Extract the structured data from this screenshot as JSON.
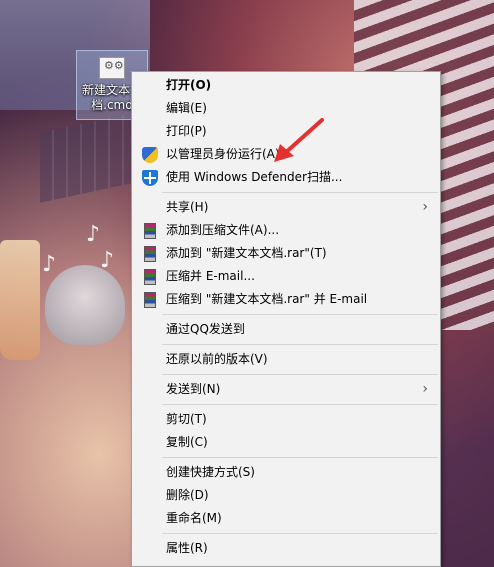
{
  "desktop": {
    "icon_label_line1": "新建文本文",
    "icon_label_line2": "档.cmd"
  },
  "menu": {
    "items": [
      {
        "label": "打开(O)",
        "bold": true
      },
      {
        "label": "编辑(E)"
      },
      {
        "label": "打印(P)"
      },
      {
        "label": "以管理员身份运行(A)",
        "icon": "uac-shield-icon"
      },
      {
        "label": "使用 Windows Defender扫描...",
        "icon": "defender-icon"
      },
      {
        "label": "共享(H)",
        "submenu": true
      },
      {
        "label": "添加到压缩文件(A)...",
        "icon": "winrar-icon"
      },
      {
        "label": "添加到 \"新建文本文档.rar\"(T)",
        "icon": "winrar-icon"
      },
      {
        "label": "压缩并 E-mail...",
        "icon": "winrar-icon"
      },
      {
        "label": "压缩到 \"新建文本文档.rar\" 并 E-mail",
        "icon": "winrar-icon"
      },
      {
        "label": "通过QQ发送到"
      },
      {
        "label": "还原以前的版本(V)"
      },
      {
        "label": "发送到(N)",
        "submenu": true
      },
      {
        "label": "剪切(T)"
      },
      {
        "label": "复制(C)"
      },
      {
        "label": "创建快捷方式(S)"
      },
      {
        "label": "删除(D)"
      },
      {
        "label": "重命名(M)"
      },
      {
        "label": "属性(R)"
      }
    ],
    "submenu_arrow": "›"
  },
  "colors": {
    "menu_bg": "#f2f2f2",
    "annotation_arrow": "#e53030"
  }
}
